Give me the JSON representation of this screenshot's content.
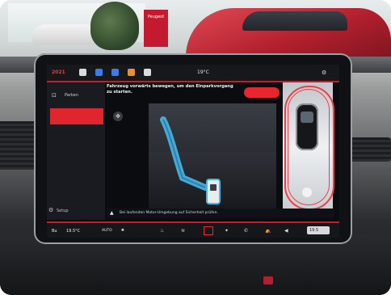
{
  "topbar": {
    "left_label": "2021",
    "temperature": "19°C",
    "settings_icon": "gear-icon",
    "icons": [
      {
        "name": "car-icon",
        "color": "#d9dbde"
      },
      {
        "name": "phone-icon",
        "color": "#3b7de0"
      },
      {
        "name": "media-icon",
        "color": "#3b7de0"
      },
      {
        "name": "nav-icon",
        "color": "#e8903a"
      },
      {
        "name": "apps-icon",
        "color": "#d9dbde"
      }
    ]
  },
  "sidebar": {
    "title": "Parken",
    "footer": "Setup"
  },
  "instruction": {
    "line1": "Fahrzeug vorwärts bewegen, um den Einparkvorgang",
    "line2": "zu starten.",
    "pill_color": "#e82630"
  },
  "warning": {
    "text": "Bei laufenden Motor-Umgebung auf Sicherheit prüfen."
  },
  "bottombar": {
    "left": "Bu",
    "temp": "19.5°C",
    "auto": "AUTO",
    "fan": "fan",
    "bright": "19.5"
  },
  "showroom": {
    "banner": "Peugeot"
  },
  "colors": {
    "accent": "#e0252f",
    "guide_line": "#47b8ea"
  }
}
